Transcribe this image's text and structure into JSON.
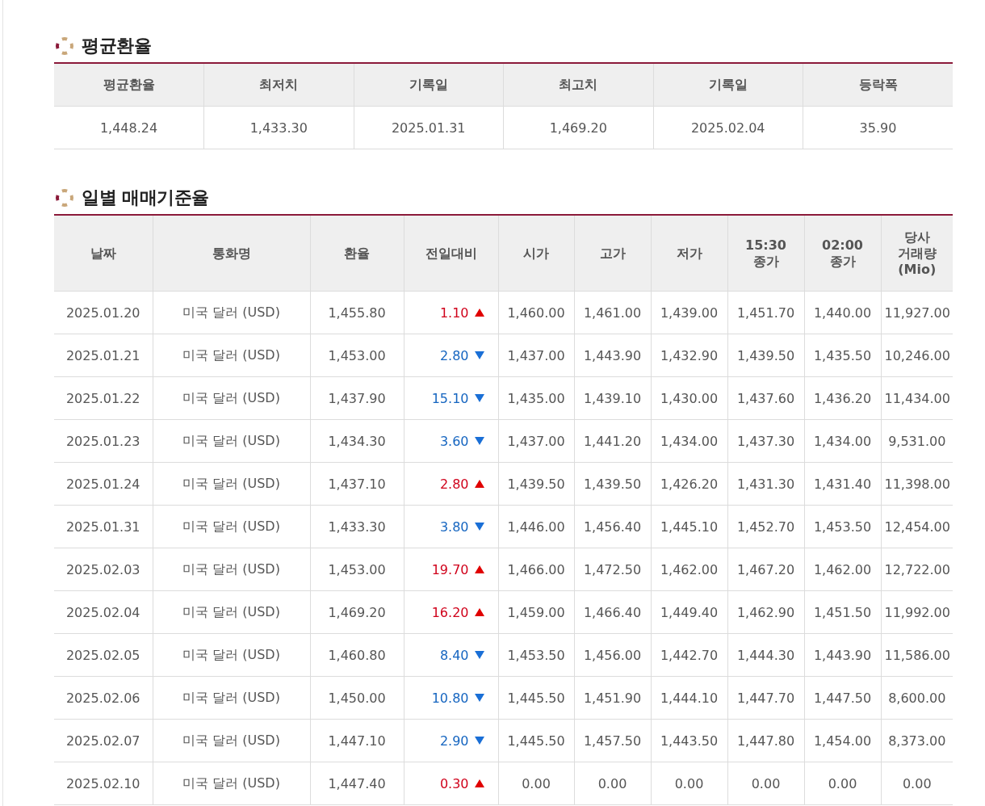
{
  "average_section": {
    "title": "평균환율",
    "columns": [
      "평균환율",
      "최저치",
      "기록일",
      "최고치",
      "기록일",
      "등락폭"
    ],
    "values": [
      "1,448.24",
      "1,433.30",
      "2025.01.31",
      "1,469.20",
      "2025.02.04",
      "35.90"
    ]
  },
  "daily_section": {
    "title": "일별 매매기준율",
    "columns": [
      "날짜",
      "통화명",
      "환율",
      "전일대비",
      "시가",
      "고가",
      "저가",
      "15:30\n종가",
      "02:00\n종가",
      "당사\n거래량\n(Mio)"
    ],
    "rows": [
      {
        "date": "2025.01.20",
        "currency": "미국 달러 (USD)",
        "rate": "1,455.80",
        "change": "1.10",
        "up": true,
        "open": "1,460.00",
        "high": "1,461.00",
        "low": "1,439.00",
        "close_1530": "1,451.70",
        "close_0200": "1,440.00",
        "volume": "11,927.00"
      },
      {
        "date": "2025.01.21",
        "currency": "미국 달러 (USD)",
        "rate": "1,453.00",
        "change": "2.80",
        "up": false,
        "open": "1,437.00",
        "high": "1,443.90",
        "low": "1,432.90",
        "close_1530": "1,439.50",
        "close_0200": "1,435.50",
        "volume": "10,246.00"
      },
      {
        "date": "2025.01.22",
        "currency": "미국 달러 (USD)",
        "rate": "1,437.90",
        "change": "15.10",
        "up": false,
        "open": "1,435.00",
        "high": "1,439.10",
        "low": "1,430.00",
        "close_1530": "1,437.60",
        "close_0200": "1,436.20",
        "volume": "11,434.00"
      },
      {
        "date": "2025.01.23",
        "currency": "미국 달러 (USD)",
        "rate": "1,434.30",
        "change": "3.60",
        "up": false,
        "open": "1,437.00",
        "high": "1,441.20",
        "low": "1,434.00",
        "close_1530": "1,437.30",
        "close_0200": "1,434.00",
        "volume": "9,531.00"
      },
      {
        "date": "2025.01.24",
        "currency": "미국 달러 (USD)",
        "rate": "1,437.10",
        "change": "2.80",
        "up": true,
        "open": "1,439.50",
        "high": "1,439.50",
        "low": "1,426.20",
        "close_1530": "1,431.30",
        "close_0200": "1,431.40",
        "volume": "11,398.00"
      },
      {
        "date": "2025.01.31",
        "currency": "미국 달러 (USD)",
        "rate": "1,433.30",
        "change": "3.80",
        "up": false,
        "open": "1,446.00",
        "high": "1,456.40",
        "low": "1,445.10",
        "close_1530": "1,452.70",
        "close_0200": "1,453.50",
        "volume": "12,454.00"
      },
      {
        "date": "2025.02.03",
        "currency": "미국 달러 (USD)",
        "rate": "1,453.00",
        "change": "19.70",
        "up": true,
        "open": "1,466.00",
        "high": "1,472.50",
        "low": "1,462.00",
        "close_1530": "1,467.20",
        "close_0200": "1,462.00",
        "volume": "12,722.00"
      },
      {
        "date": "2025.02.04",
        "currency": "미국 달러 (USD)",
        "rate": "1,469.20",
        "change": "16.20",
        "up": true,
        "open": "1,459.00",
        "high": "1,466.40",
        "low": "1,449.40",
        "close_1530": "1,462.90",
        "close_0200": "1,451.50",
        "volume": "11,992.00"
      },
      {
        "date": "2025.02.05",
        "currency": "미국 달러 (USD)",
        "rate": "1,460.80",
        "change": "8.40",
        "up": false,
        "open": "1,453.50",
        "high": "1,456.00",
        "low": "1,442.70",
        "close_1530": "1,444.30",
        "close_0200": "1,443.90",
        "volume": "11,586.00"
      },
      {
        "date": "2025.02.06",
        "currency": "미국 달러 (USD)",
        "rate": "1,450.00",
        "change": "10.80",
        "up": false,
        "open": "1,445.50",
        "high": "1,451.90",
        "low": "1,444.10",
        "close_1530": "1,447.70",
        "close_0200": "1,447.50",
        "volume": "8,600.00"
      },
      {
        "date": "2025.02.07",
        "currency": "미국 달러 (USD)",
        "rate": "1,447.10",
        "change": "2.90",
        "up": false,
        "open": "1,445.50",
        "high": "1,457.50",
        "low": "1,443.50",
        "close_1530": "1,447.80",
        "close_0200": "1,454.00",
        "volume": "8,373.00"
      },
      {
        "date": "2025.02.10",
        "currency": "미국 달러 (USD)",
        "rate": "1,447.40",
        "change": "0.30",
        "up": true,
        "open": "0.00",
        "high": "0.00",
        "low": "0.00",
        "close_1530": "0.00",
        "close_0200": "0.00",
        "volume": "0.00"
      }
    ]
  }
}
